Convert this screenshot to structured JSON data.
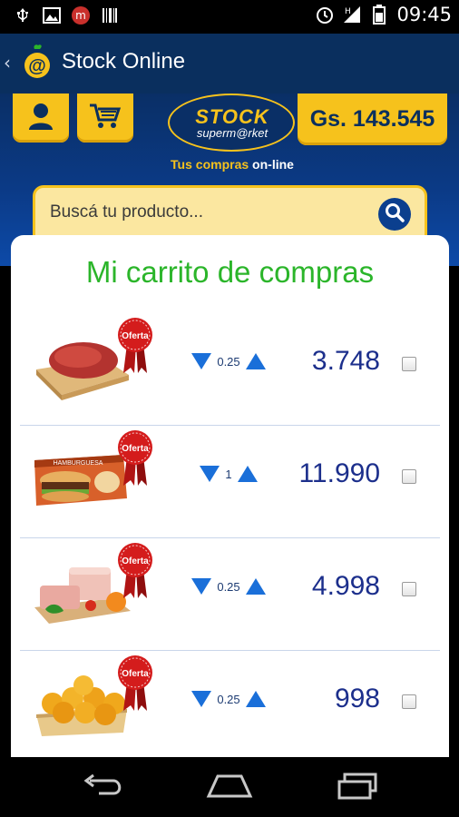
{
  "status_bar": {
    "time": "09:45"
  },
  "action_bar": {
    "title": "Stock Online"
  },
  "header": {
    "balance": "Gs. 143.545",
    "brand_stock": "STOCK",
    "brand_super": "superm@rket",
    "tagline_a": "Tus compras ",
    "tagline_b": "on-line"
  },
  "search": {
    "placeholder": "Buscá tu producto..."
  },
  "cart": {
    "title": "Mi carrito de compras",
    "badge_label": "Oferta",
    "items": [
      {
        "qty": "0.25",
        "price": "3.748",
        "product_icon": "meat-icon"
      },
      {
        "qty": "1",
        "price": "11.990",
        "product_icon": "burger-box-icon"
      },
      {
        "qty": "0.25",
        "price": "4.998",
        "product_icon": "ham-icon"
      },
      {
        "qty": "0.25",
        "price": "998",
        "product_icon": "oranges-icon"
      }
    ]
  },
  "colors": {
    "accent": "#f6c21c",
    "navy": "#0a2f5e",
    "green": "#2bb52a",
    "blue": "#1a6fd9"
  }
}
